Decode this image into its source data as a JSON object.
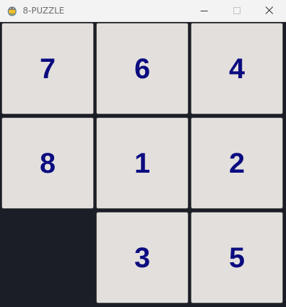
{
  "window": {
    "title": "8-PUZZLE",
    "app_icon": "pygame-snake-icon",
    "controls": [
      "minimize-icon",
      "maximize-icon",
      "close-icon"
    ]
  },
  "colors": {
    "background": "#1b1e26",
    "tile": "#e2dfdd",
    "tile_text": "#0b0b80",
    "titlebar": "#f3f3f3"
  },
  "board": {
    "rows": [
      [
        "7",
        "6",
        "4"
      ],
      [
        "8",
        "1",
        "2"
      ],
      [
        "",
        "3",
        "5"
      ]
    ]
  }
}
